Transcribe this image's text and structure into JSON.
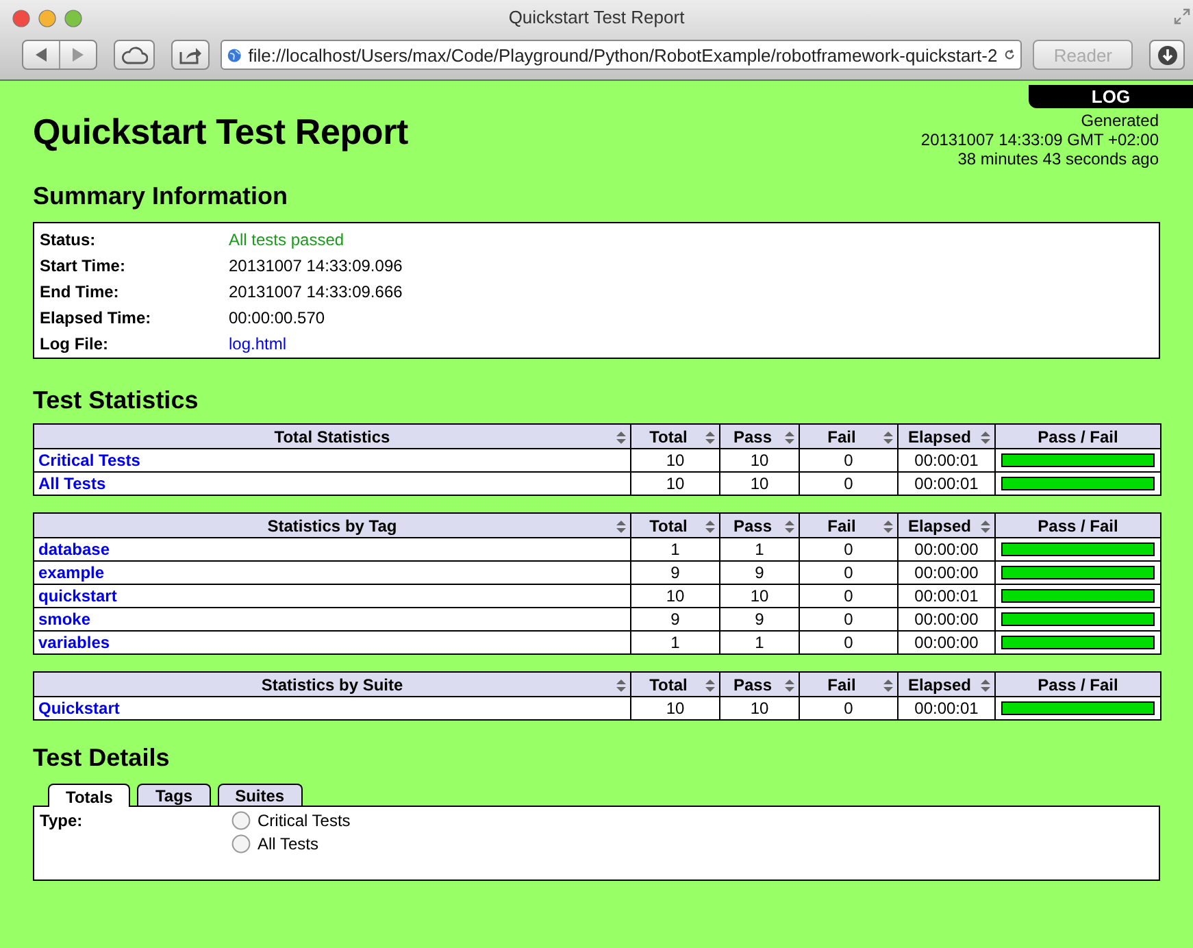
{
  "window": {
    "title": "Quickstart Test Report"
  },
  "toolbar": {
    "url": "file://localhost/Users/max/Code/Playground/Python/RobotExample/robotframework-quickstart-2",
    "reader": {
      "label": "Reader",
      "disabled": true
    }
  },
  "report": {
    "log_tab": "LOG",
    "generated": [
      "Generated",
      "20131007 14:33:09 GMT +02:00",
      "38 minutes 43 seconds ago"
    ],
    "title": "Quickstart Test Report"
  },
  "summary": {
    "heading": "Summary Information",
    "rows": [
      {
        "label": "Status:",
        "value": "All tests passed",
        "kind": "status"
      },
      {
        "label": "Start Time:",
        "value": "20131007 14:33:09.096",
        "kind": "text"
      },
      {
        "label": "End Time:",
        "value": "20131007 14:33:09.666",
        "kind": "text"
      },
      {
        "label": "Elapsed Time:",
        "value": "00:00:00.570",
        "kind": "text"
      },
      {
        "label": "Log File:",
        "value": "log.html",
        "kind": "link"
      }
    ]
  },
  "statistics": {
    "heading": "Test Statistics",
    "tables": [
      {
        "columns": [
          {
            "label": "Total Statistics",
            "sortable": true
          },
          {
            "label": "Total",
            "sortable": true
          },
          {
            "label": "Pass",
            "sortable": true
          },
          {
            "label": "Fail",
            "sortable": true
          },
          {
            "label": "Elapsed",
            "sortable": true
          },
          {
            "label": "Pass / Fail",
            "sortable": false
          }
        ],
        "rows": [
          {
            "name": "Critical Tests",
            "total": "10",
            "pass": "10",
            "fail": "0",
            "elapsed": "00:00:01",
            "level": 1
          },
          {
            "name": "All Tests",
            "total": "10",
            "pass": "10",
            "fail": "0",
            "elapsed": "00:00:01",
            "level": 1
          }
        ]
      },
      {
        "columns": [
          {
            "label": "Statistics by Tag",
            "sortable": true
          },
          {
            "label": "Total",
            "sortable": true
          },
          {
            "label": "Pass",
            "sortable": true
          },
          {
            "label": "Fail",
            "sortable": true
          },
          {
            "label": "Elapsed",
            "sortable": true
          },
          {
            "label": "Pass / Fail",
            "sortable": false
          }
        ],
        "rows": [
          {
            "name": "database",
            "total": "1",
            "pass": "1",
            "fail": "0",
            "elapsed": "00:00:00",
            "level": 1
          },
          {
            "name": "example",
            "total": "9",
            "pass": "9",
            "fail": "0",
            "elapsed": "00:00:00",
            "level": 1
          },
          {
            "name": "quickstart",
            "total": "10",
            "pass": "10",
            "fail": "0",
            "elapsed": "00:00:01",
            "level": 1
          },
          {
            "name": "smoke",
            "total": "9",
            "pass": "9",
            "fail": "0",
            "elapsed": "00:00:00",
            "level": 1
          },
          {
            "name": "variables",
            "total": "1",
            "pass": "1",
            "fail": "0",
            "elapsed": "00:00:00",
            "level": 1
          }
        ]
      },
      {
        "columns": [
          {
            "label": "Statistics by Suite",
            "sortable": true
          },
          {
            "label": "Total",
            "sortable": true
          },
          {
            "label": "Pass",
            "sortable": true
          },
          {
            "label": "Fail",
            "sortable": true
          },
          {
            "label": "Elapsed",
            "sortable": true
          },
          {
            "label": "Pass / Fail",
            "sortable": false
          }
        ],
        "rows": [
          {
            "name": "Quickstart",
            "total": "10",
            "pass": "10",
            "fail": "0",
            "elapsed": "00:00:01",
            "level": 1
          }
        ]
      }
    ]
  },
  "details": {
    "heading": "Test Details",
    "tabs": [
      {
        "label": "Totals",
        "selected": true
      },
      {
        "label": "Tags",
        "selected": false
      },
      {
        "label": "Suites",
        "selected": false
      }
    ],
    "type_label": "Type:",
    "options": [
      {
        "label": "Critical Tests",
        "selected": false
      },
      {
        "label": "All Tests",
        "selected": false
      }
    ]
  }
}
